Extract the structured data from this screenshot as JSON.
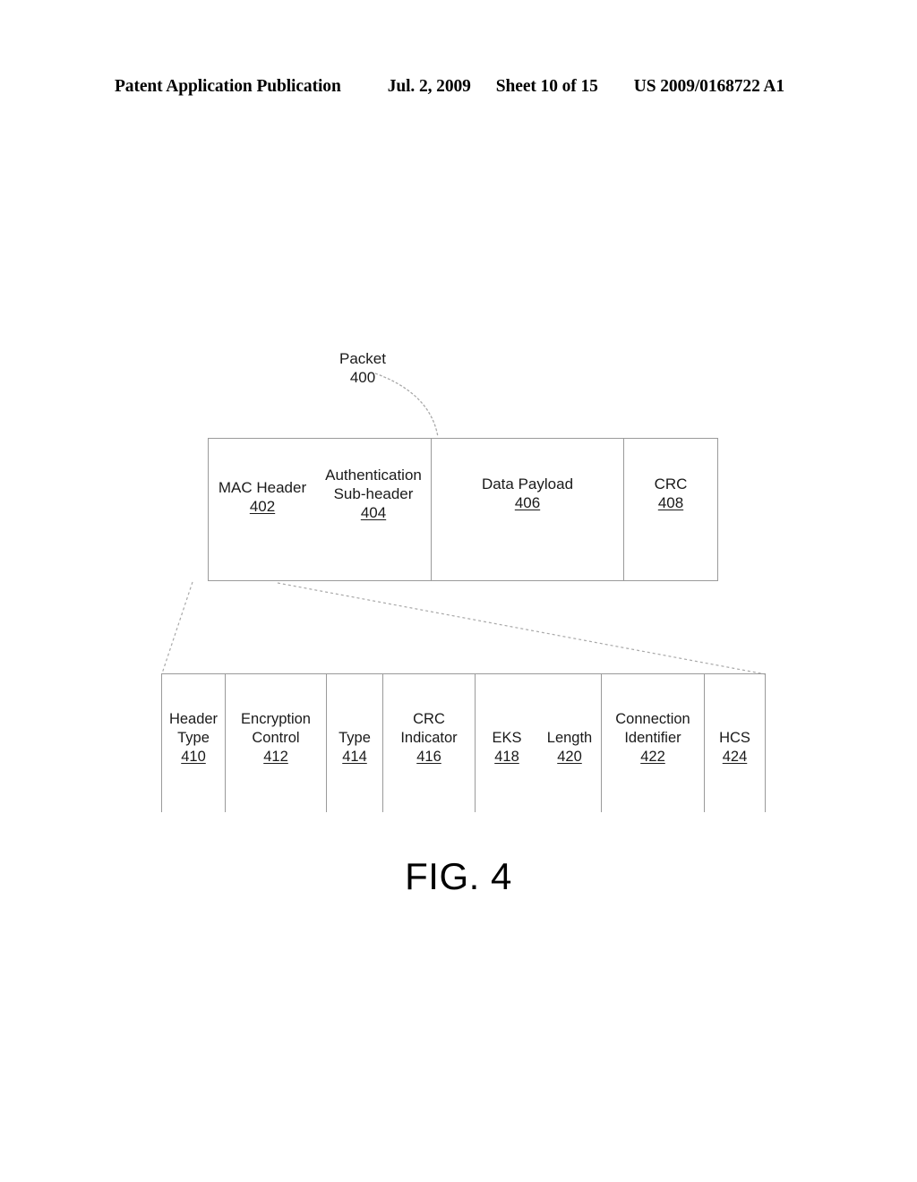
{
  "header": {
    "publication": "Patent Application Publication",
    "date": "Jul. 2, 2009",
    "sheet": "Sheet 10 of 15",
    "patent_number": "US 2009/0168722 A1"
  },
  "figure": {
    "caption": "FIG. 4",
    "callout": {
      "label": "Packet",
      "ref": "400"
    },
    "packet_structure": {
      "cells": [
        {
          "label": "MAC Header",
          "ref": "402"
        },
        {
          "label_line1": "Authentication",
          "label_line2": "Sub-header",
          "ref": "404"
        },
        {
          "label": "Data Payload",
          "ref": "406"
        },
        {
          "label": "CRC",
          "ref": "408"
        }
      ]
    },
    "mac_header_fields": {
      "fields": [
        {
          "label_line1": "Header",
          "label_line2": "Type",
          "ref": "410"
        },
        {
          "label_line1": "Encryption",
          "label_line2": "Control",
          "ref": "412"
        },
        {
          "label_line1": "Type",
          "ref": "414"
        },
        {
          "label_line1": "CRC",
          "label_line2": "Indicator",
          "ref": "416"
        },
        {
          "label_line1": "EKS",
          "ref": "418"
        },
        {
          "label_line1": "Length",
          "ref": "420"
        },
        {
          "label_line1": "Connection",
          "label_line2": "Identifier",
          "ref": "422"
        },
        {
          "label_line1": "HCS",
          "ref": "424"
        }
      ]
    }
  },
  "colors": {
    "line": "#9a9a9a",
    "text": "#1a1a1a",
    "leader": "#a8a8a8"
  }
}
